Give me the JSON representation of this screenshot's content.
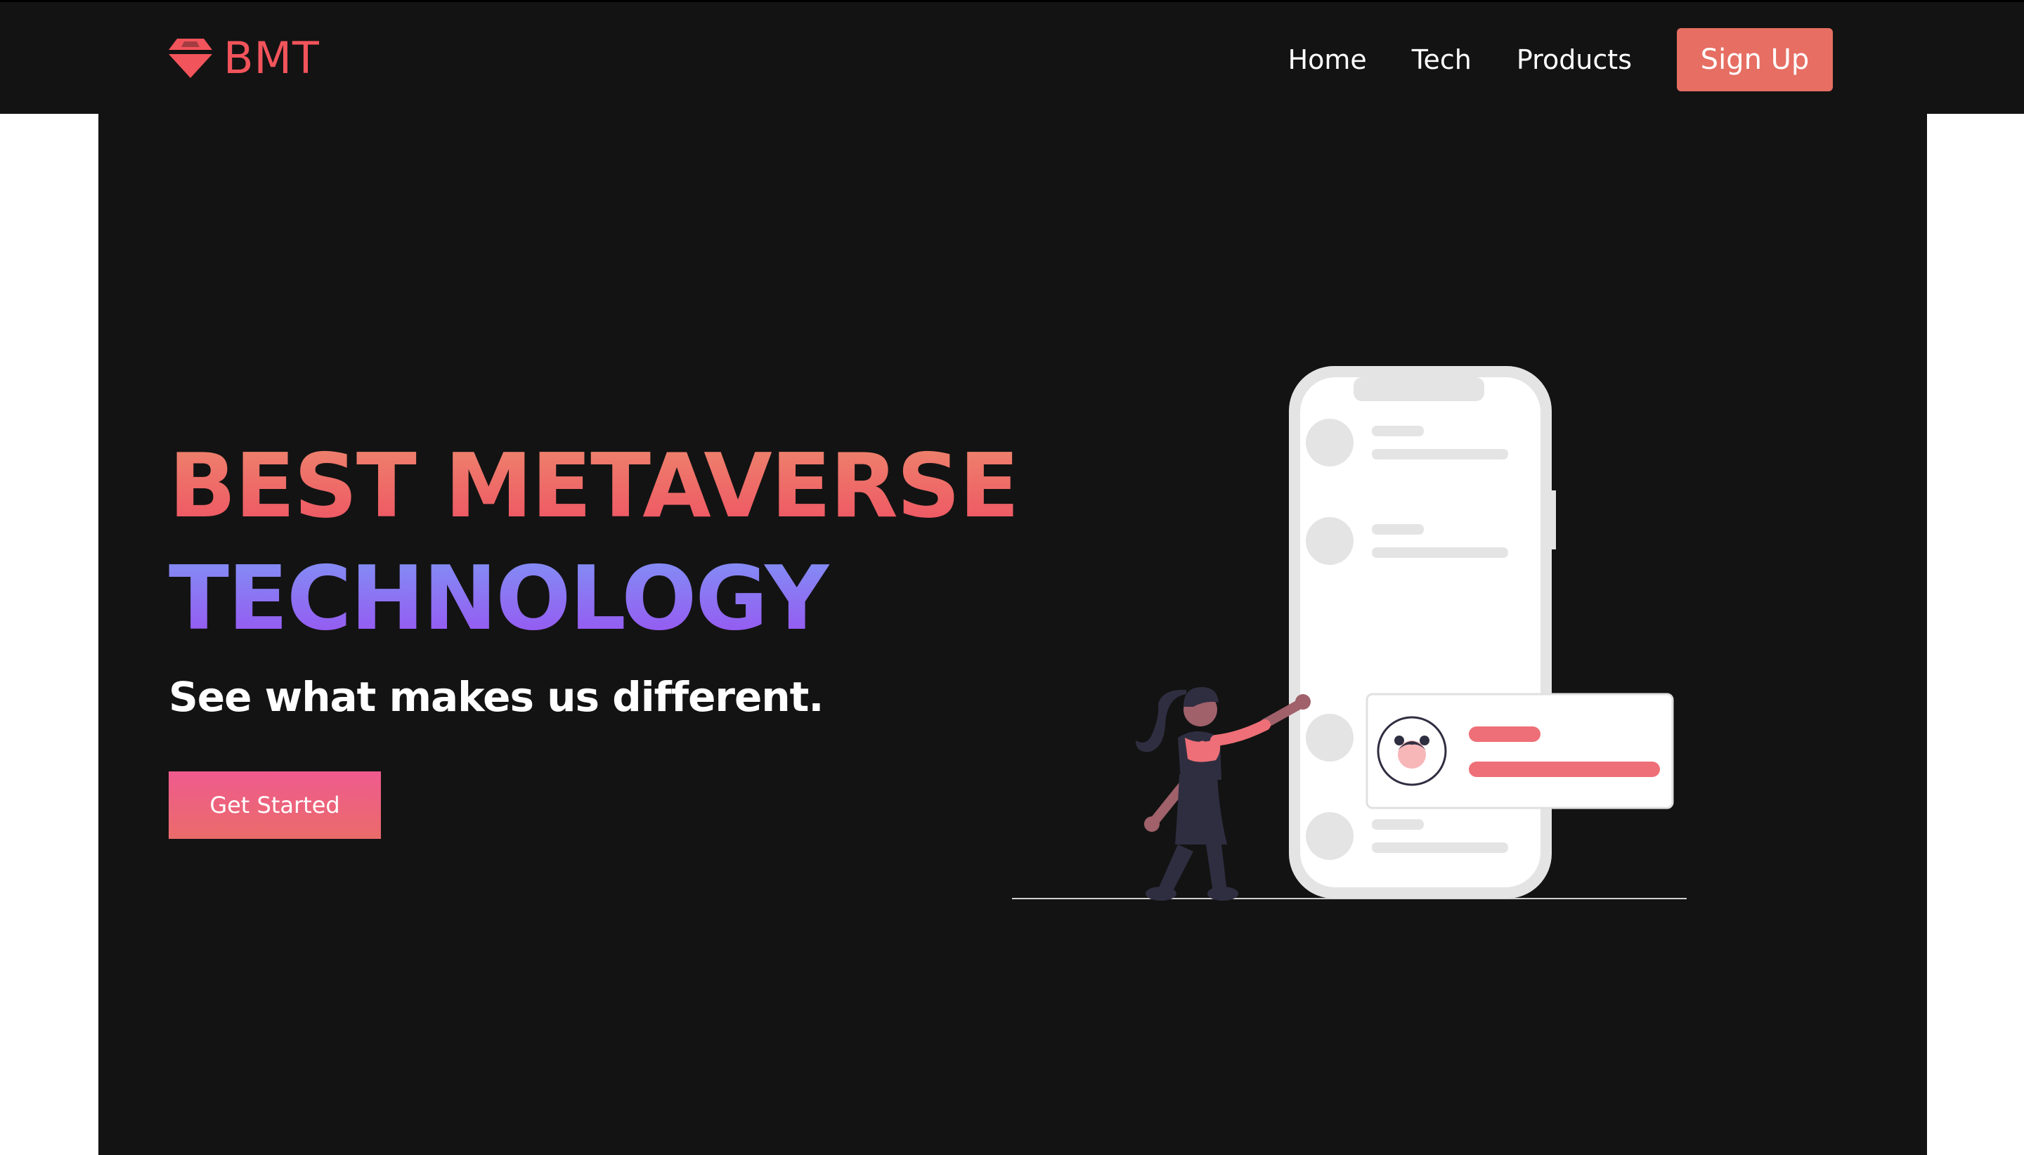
{
  "brand": {
    "name": "BMT",
    "icon": "gem-icon",
    "color": "#f2545b"
  },
  "nav": {
    "links": [
      {
        "label": "Home"
      },
      {
        "label": "Tech"
      },
      {
        "label": "Products"
      }
    ],
    "signup_label": "Sign Up",
    "signup_color": "#e66e63"
  },
  "hero": {
    "heading_line1": "BEST METAVERSE",
    "heading_line2": "TECHNOLOGY",
    "subtitle": "See what makes us different.",
    "cta_label": "Get Started",
    "background": "#131313"
  },
  "illustration": {
    "icon": "woman-with-phone-illustration",
    "accent": "#ee6f77"
  }
}
